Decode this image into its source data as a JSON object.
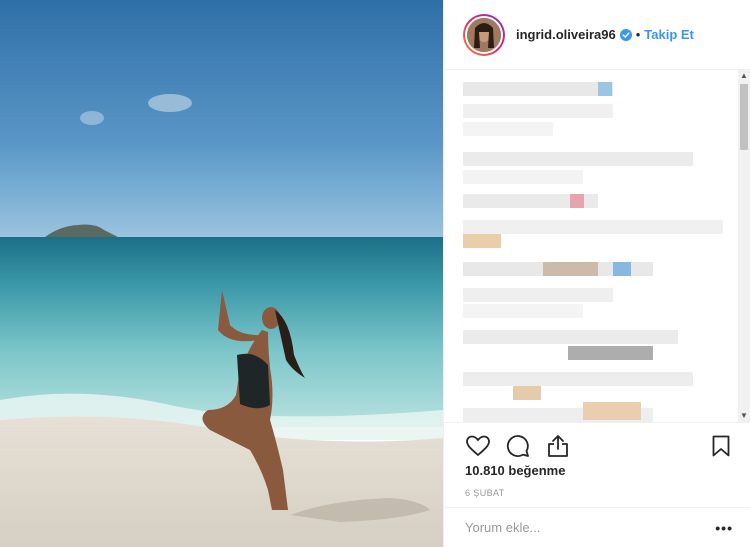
{
  "post": {
    "username": "ingrid.oliveira96",
    "separator": "•",
    "follow_label": "Takip Et",
    "likes_text": "10.810 beğenme",
    "date_text": "6 ŞUBAT",
    "comment_placeholder": "Yorum ekle...",
    "more_label": "•••"
  },
  "icons": {
    "verified": "verified-badge-icon",
    "like": "heart-icon",
    "comment": "speech-bubble-icon",
    "share": "share-icon",
    "save": "bookmark-icon"
  },
  "colors": {
    "accent": "#3897f0",
    "text": "#262626",
    "muted": "#999999"
  }
}
